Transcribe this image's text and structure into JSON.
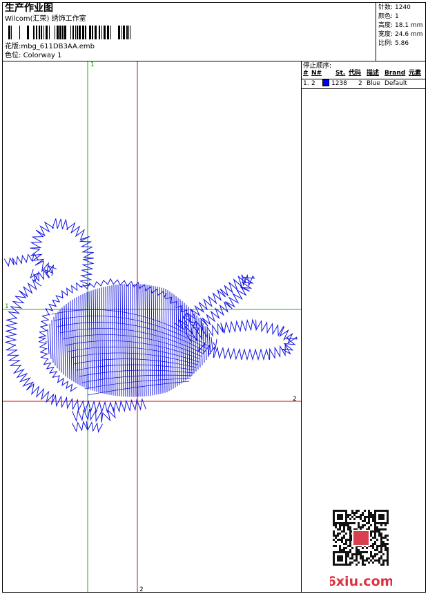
{
  "header": {
    "title": "生产作业图",
    "studio": "Wilcom(汇荣) 绣饰工作室",
    "pattern_label": "花版:",
    "pattern_value": "mbg_611DB3AA.emb",
    "colorway_label": "色位:",
    "colorway_value": "Colorway 1"
  },
  "stats": [
    {
      "label": "针数:",
      "value": "1240"
    },
    {
      "label": "颜色:",
      "value": "1"
    },
    {
      "label": "高度:",
      "value": "18.1 mm"
    },
    {
      "label": "宽度:",
      "value": "24.6 mm"
    },
    {
      "label": "比例:",
      "value": "5.86"
    }
  ],
  "stop_sequence": {
    "title": "停止顺序:",
    "columns": [
      "#",
      "N#",
      "St.",
      "代码",
      "描述",
      "Brand",
      "元素"
    ],
    "rows": [
      {
        "index": "1.",
        "needle": "2",
        "stitches": "1238",
        "code": "2",
        "desc": "Blue",
        "brand": "Default",
        "color": "#0000ee"
      }
    ]
  },
  "axis_labels": {
    "green_v": "1",
    "green_h": "1",
    "red_h": "2",
    "red_v": "2"
  },
  "colors": {
    "thread": "#1010e0",
    "green_guide": "#00c000",
    "red_guide": "#e00000"
  },
  "watermark": {
    "text": "6xiu.com",
    "color": "#e03040"
  }
}
